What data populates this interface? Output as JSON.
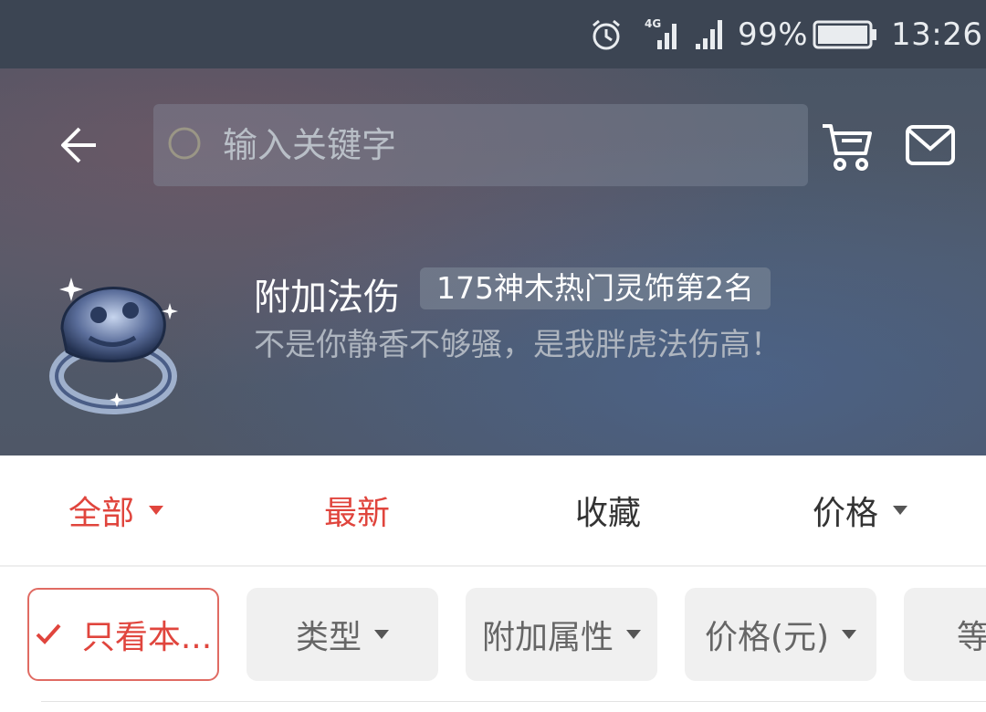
{
  "status_bar": {
    "alarm_icon": "alarm-clock-icon",
    "network_label": "4G",
    "battery_percent": "99%",
    "time": "13:26"
  },
  "header": {
    "search_placeholder": "输入关键字",
    "item": {
      "name": "附加法伤",
      "rank_badge": "175神木热门灵饰第2名",
      "description": "不是你静香不够骚，是我胖虎法伤高！"
    }
  },
  "sort_tabs": [
    {
      "label": "全部",
      "active": true,
      "has_dropdown": true
    },
    {
      "label": "最新",
      "active": true,
      "has_dropdown": false
    },
    {
      "label": "收藏",
      "active": false,
      "has_dropdown": false
    },
    {
      "label": "价格",
      "active": false,
      "has_dropdown": true
    }
  ],
  "filter_chips": [
    {
      "label": "只看本...",
      "checked": true
    },
    {
      "label": "类型",
      "has_dropdown": true
    },
    {
      "label": "附加属性",
      "has_dropdown": true
    },
    {
      "label": "价格(元)",
      "has_dropdown": true
    },
    {
      "label": "等",
      "has_dropdown": false
    }
  ],
  "colors": {
    "accent_red": "#e0453d",
    "header_bg": "#505a6a",
    "status_bar_bg": "#3c4553"
  }
}
